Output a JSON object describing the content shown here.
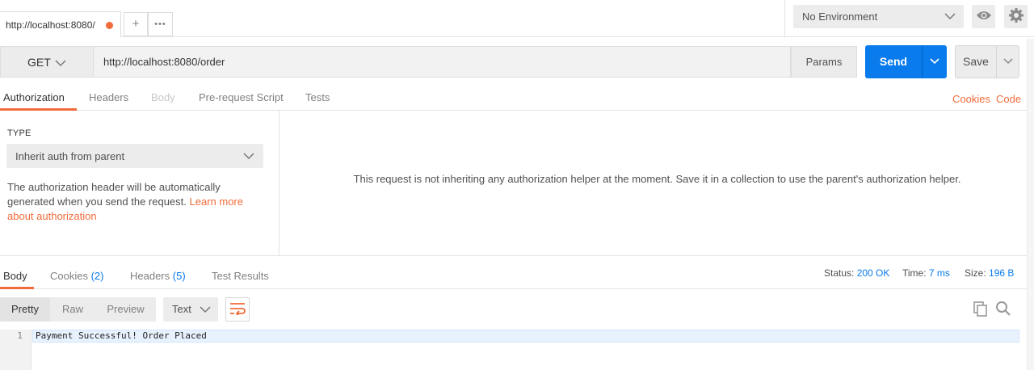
{
  "tabbar": {
    "active_tab_label": "http://localhost:8080/",
    "new_tab_symbol": "+",
    "more_tabs_symbol": "•••",
    "environment": "No Environment"
  },
  "request": {
    "method": "GET",
    "url": "http://localhost:8080/order",
    "params_label": "Params",
    "send_label": "Send",
    "save_label": "Save"
  },
  "request_tabs": {
    "items": [
      "Authorization",
      "Headers",
      "Body",
      "Pre-request Script",
      "Tests"
    ],
    "active": "Authorization",
    "disabled": "Body",
    "cookies_link": "Cookies",
    "code_link": "Code"
  },
  "auth": {
    "type_label": "TYPE",
    "type_value": "Inherit auth from parent",
    "description": "The authorization header will be automatically generated when you send the request. ",
    "learn_more_link": "Learn more about authorization",
    "message": "This request is not inheriting any authorization helper at the moment. Save it in a collection to use the parent's authorization helper."
  },
  "response_tabs": {
    "body": "Body",
    "cookies": "Cookies",
    "cookies_count": "(2)",
    "headers": "Headers",
    "headers_count": "(5)",
    "test_results": "Test Results"
  },
  "status": {
    "status_label": "Status:",
    "status_value": "200 OK",
    "time_label": "Time:",
    "time_value": "7 ms",
    "size_label": "Size:",
    "size_value": "196 B"
  },
  "response_view": {
    "pretty": "Pretty",
    "raw": "Raw",
    "preview": "Preview",
    "format": "Text"
  },
  "response_body": {
    "line_number": "1",
    "text": "Payment Successful! Order Placed"
  },
  "colors": {
    "accent_orange": "#f26b3a",
    "send_blue": "#097bed",
    "link_blue": "#097bed"
  }
}
